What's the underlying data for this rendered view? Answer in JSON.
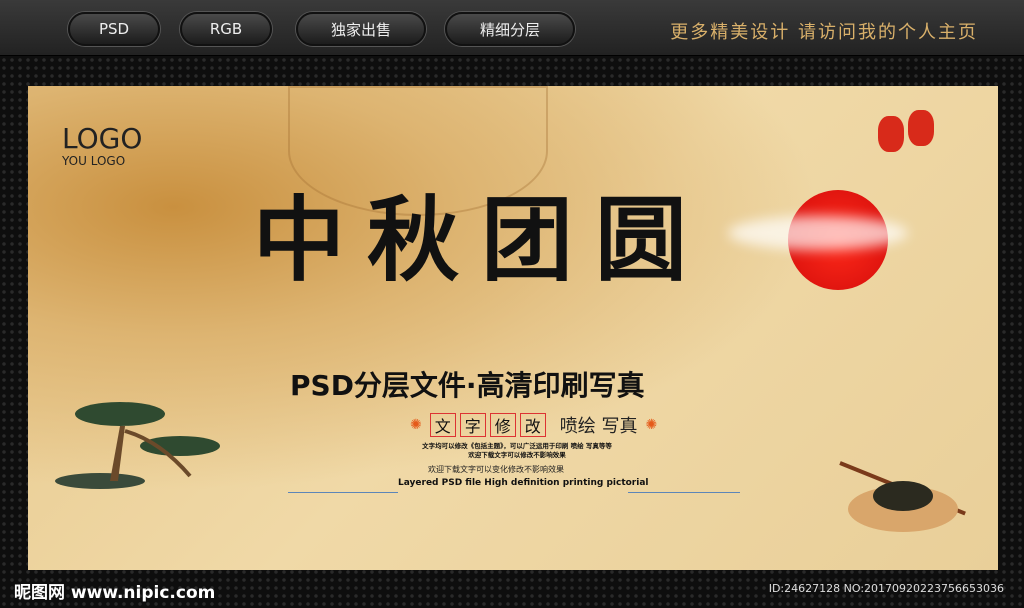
{
  "topbar": {
    "tabs": [
      "PSD",
      "RGB",
      "独家出售",
      "精细分层"
    ],
    "promo": "更多精美设计 请访问我的个人主页"
  },
  "poster": {
    "logo": "LOGO",
    "logo_sub": "YOU LOGO",
    "title": "中秋团圆",
    "subtitle": "PSD分层文件·高清印刷写真",
    "boxed_chars": [
      "文",
      "字",
      "修",
      "改"
    ],
    "extra": "喷绘 写真",
    "small_line1": "文字均可以修改《包括主题》，可以广泛运用于印刷 喷绘 写真等等",
    "small_line2": "欢迎下载文字可以修改不影响效果",
    "small_line3": "欢迎下载文字可以变化修改不影响效果",
    "english": "Layered PSD file High definition printing pictorial"
  },
  "footer": {
    "watermark": "昵图网 www.nipic.com",
    "id": "ID:24627128 NO:20170920223756653036"
  }
}
